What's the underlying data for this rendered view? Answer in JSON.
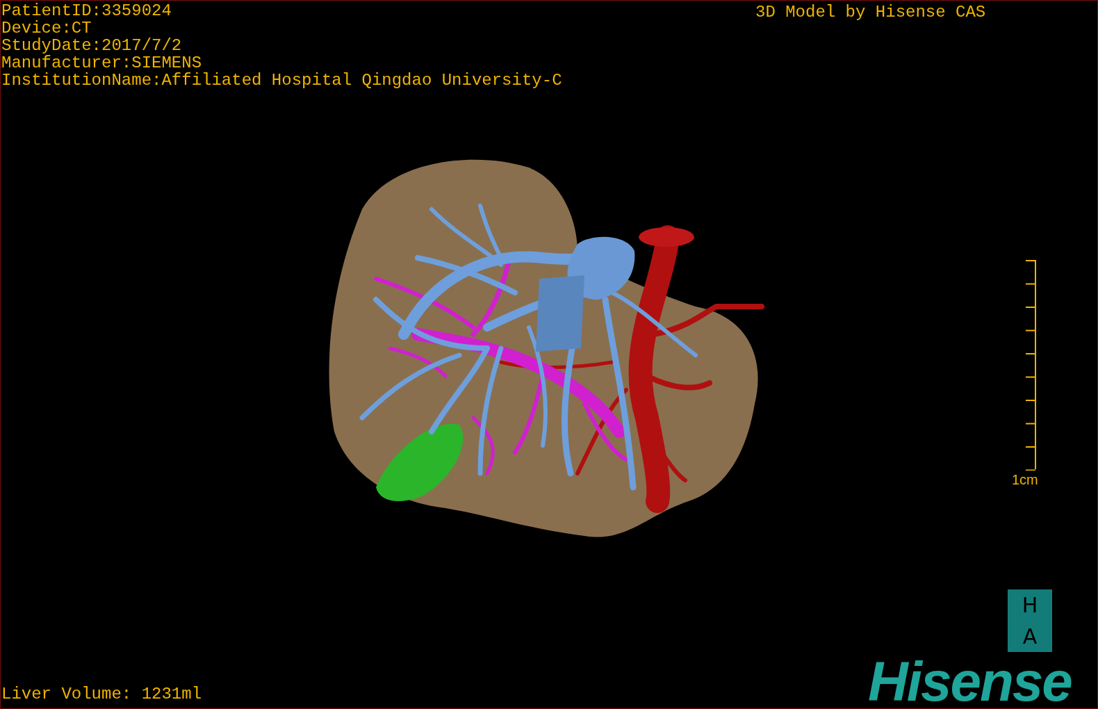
{
  "patient_info": [
    "PatientID:3359024",
    "Device:CT",
    "StudyDate:2017/7/2",
    "Manufacturer:SIEMENS",
    "InstitutionName:Affiliated Hospital Qingdao University-C"
  ],
  "title": "3D Model by Hisense CAS",
  "scale_bar": {
    "label": "1cm"
  },
  "orientation_marker": [
    "H",
    "A"
  ],
  "liver_volume": "Liver Volume: 1231ml",
  "logo": "Hisense"
}
